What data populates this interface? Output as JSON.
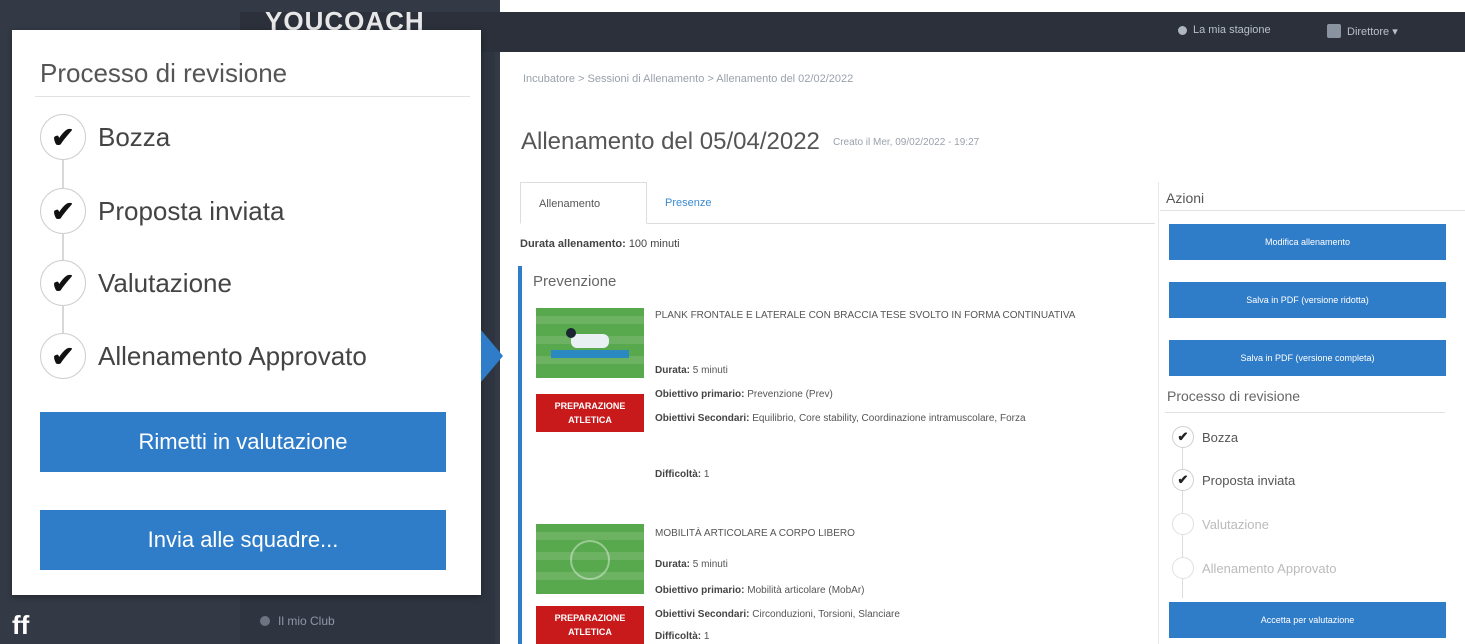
{
  "app": {
    "logo": "YOUCOACH",
    "top_links": [
      "La mia stagione",
      "Direttore ▾"
    ]
  },
  "sidebar": {
    "items": [
      {
        "label": "Il mio Club"
      }
    ]
  },
  "breadcrumb": "Incubatore > Sessioni di Allenamento > Allenamento del 02/02/2022",
  "page": {
    "title": "Allenamento del 05/04/2022",
    "subtitle": "Creato il Mer, 09/02/2022 - 19:27"
  },
  "tabs": [
    {
      "label": "Allenamento",
      "active": true
    },
    {
      "label": "Presenze",
      "active": false
    }
  ],
  "duration": {
    "label": "Durata allenamento:",
    "value": "100 minuti"
  },
  "section": {
    "title": "Prevenzione"
  },
  "exercises": [
    {
      "title": "PLANK FRONTALE E LATERALE CON BRACCIA TESE SVOLTO IN FORMA CONTINUATIVA",
      "badge": "PREPARAZIONE ATLETICA",
      "duration_label": "Durata:",
      "duration_value": "5 minuti",
      "primary_label": "Obiettivo primario:",
      "primary_value": "Prevenzione (Prev)",
      "secondary_label": "Obiettivi Secondari:",
      "secondary_value": "Equilibrio, Core stability, Coordinazione intramuscolare, Forza",
      "difficulty_label": "Difficoltà:",
      "difficulty_value": "1"
    },
    {
      "title": "MOBILITÀ ARTICOLARE A CORPO LIBERO",
      "badge": "PREPARAZIONE ATLETICA",
      "duration_label": "Durata:",
      "duration_value": "5 minuti",
      "primary_label": "Obiettivo primario:",
      "primary_value": "Mobilità articolare (MobAr)",
      "secondary_label": "Obiettivi Secondari:",
      "secondary_value": "Circonduzioni, Torsioni, Slanciare",
      "difficulty_label": "Difficoltà:",
      "difficulty_value": "1"
    }
  ],
  "actions": {
    "title": "Azioni",
    "buttons": [
      "Modifica allenamento",
      "Salva in PDF (versione ridotta)",
      "Salva in PDF (versione completa)"
    ],
    "review_title": "Processo di revisione",
    "steps": [
      {
        "label": "Bozza",
        "done": true
      },
      {
        "label": "Proposta inviata",
        "done": true
      },
      {
        "label": "Valutazione",
        "done": false
      },
      {
        "label": "Allenamento Approvato",
        "done": false
      }
    ],
    "accept_button": "Accetta per valutazione"
  },
  "zoom": {
    "title": "Processo di revisione",
    "steps": [
      {
        "label": "Bozza",
        "done": true
      },
      {
        "label": "Proposta inviata",
        "done": true
      },
      {
        "label": "Valutazione",
        "done": true
      },
      {
        "label": "Allenamento Approvato",
        "done": true
      }
    ],
    "buttons": [
      "Rimetti in valutazione",
      "Invia alle squadre..."
    ],
    "check_glyph": "✔"
  },
  "colors": {
    "primary": "#2f7cc8",
    "badge_red": "#c8191b",
    "dark_chrome": "#2b303a"
  },
  "bottom_left_text": "ff"
}
